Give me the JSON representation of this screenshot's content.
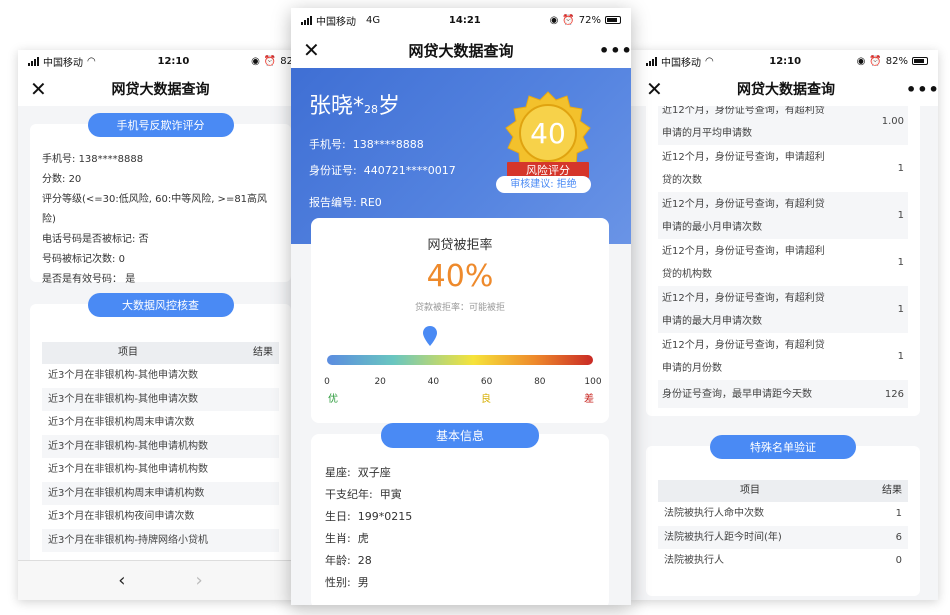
{
  "left": {
    "status": {
      "carrier": "中国移动",
      "time": "12:10",
      "battery": "82"
    },
    "title": "网贷大数据查询",
    "anti_fraud": {
      "pill": "手机号反欺诈评分",
      "phone_label": "手机号:",
      "phone": "138****8888",
      "score_label": "分数:",
      "score": "20",
      "level_text": "评分等级(<=30:低风险, 60:中等风险, >=81高风险)",
      "marked_label": "电话号码是否被标记:",
      "marked": "否",
      "mark_count_label": "号码被标记次数:",
      "mark_count": "0",
      "valid_label": "是否是有效号码：",
      "valid": "是"
    },
    "risk": {
      "pill": "大数据风控核查",
      "col_item": "项目",
      "col_result": "结果",
      "rows": [
        "近3个月在非银机构-其他申请次数",
        "近3个月在非银机构-其他申请次数",
        "近3个月在非银机构周末申请次数",
        "近3个月在非银机构-其他申请机构数",
        "近3个月在非银机构-其他申请机构数",
        "近3个月在非银机构周末申请机构数",
        "近3个月在非银机构夜间申请次数",
        "近3个月在非银机构-持牌网络小贷机"
      ]
    },
    "nav": {
      "back": "‹",
      "forward": "›"
    }
  },
  "center": {
    "status": {
      "carrier": "中国移动",
      "network": "4G",
      "time": "14:21",
      "battery": "72%"
    },
    "title": "网贷大数据查询",
    "name": "张晓*",
    "age": "28",
    "age_unit": "岁",
    "phone_label": "手机号:",
    "phone": "138****8888",
    "id_label": "身份证号:",
    "id": "440721****0017",
    "report_label": "报告编号:",
    "report": "RE0",
    "badge_score": "40",
    "badge_label": "风险评分",
    "advice": "审核建议:   拒绝",
    "rate": {
      "title": "网贷被拒率",
      "value": "40%",
      "value_num": 40,
      "desc": "贷款被拒率：可能被拒",
      "ticks": [
        "0",
        "20",
        "40",
        "60",
        "80",
        "100"
      ],
      "levels": [
        "优",
        "良",
        "差"
      ]
    },
    "basic": {
      "pill": "基本信息",
      "rows": [
        {
          "label": "星座:",
          "value": "双子座"
        },
        {
          "label": "干支纪年:",
          "value": "甲寅"
        },
        {
          "label": "生日:",
          "value": "199*0215"
        },
        {
          "label": "生肖:",
          "value": "虎"
        },
        {
          "label": "年龄:",
          "value": "28"
        },
        {
          "label": "性别:",
          "value": "男"
        }
      ]
    }
  },
  "right": {
    "status": {
      "carrier": "中国移动",
      "time": "12:10",
      "battery": "82%"
    },
    "title": "网贷大数据查询",
    "rows": [
      {
        "l1": "近12个月，身份证号查询，有超利贷",
        "l2": "申请的月平均申请数",
        "v": "1.00"
      },
      {
        "l1": "近12个月，身份证号查询，申请超利",
        "l2": "贷的次数",
        "v": "1"
      },
      {
        "l1": "近12个月，身份证号查询，有超利贷",
        "l2": "申请的最小月申请次数",
        "v": "1"
      },
      {
        "l1": "近12个月，身份证号查询，申请超利",
        "l2": "贷的机构数",
        "v": "1"
      },
      {
        "l1": "近12个月，身份证号查询，有超利贷",
        "l2": "申请的最大月申请次数",
        "v": "1"
      },
      {
        "l1": "近12个月，身份证号查询，有超利贷",
        "l2": "申请的月份数",
        "v": "1"
      },
      {
        "l1": "身份证号查询，最早申请距今天数",
        "l2": "",
        "v": "126"
      }
    ],
    "special": {
      "pill": "特殊名单验证",
      "col_item": "项目",
      "col_result": "结果",
      "rows": [
        {
          "label": "法院被执行人命中次数",
          "v": "1"
        },
        {
          "label": "法院被执行人距今时间(年)",
          "v": "6"
        },
        {
          "label": "法院被执行人",
          "v": "0"
        }
      ]
    }
  }
}
